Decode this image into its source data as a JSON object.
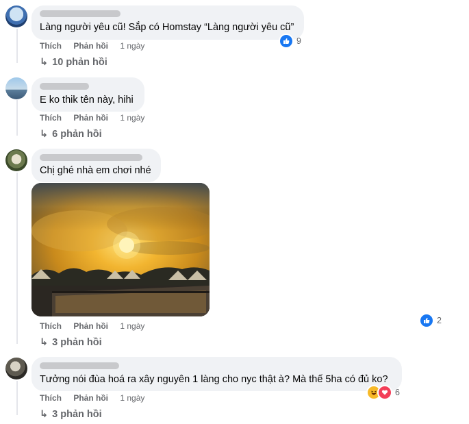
{
  "comments": [
    {
      "text": "Làng người yêu cũ! Sắp có Homstay “Làng người yêu cũ”",
      "actions": {
        "like": "Thích",
        "reply": "Phản hồi",
        "time": "1 ngày"
      },
      "reaction_count": "9",
      "reactions": [
        "like-icon"
      ],
      "replies_label": "10 phản hồi"
    },
    {
      "text": "E ko thik tên này, hihi",
      "actions": {
        "like": "Thích",
        "reply": "Phản hồi",
        "time": "1 ngày"
      },
      "replies_label": "6 phản hồi"
    },
    {
      "text": "Chị ghé nhà em chơi nhé",
      "has_photo": true,
      "actions": {
        "like": "Thích",
        "reply": "Phản hồi",
        "time": "1 ngày"
      },
      "reaction_count": "2",
      "reactions": [
        "like-icon"
      ],
      "replies_label": "3 phản hồi"
    },
    {
      "text": "Tưởng nói đùa hoá ra xây nguyên 1 làng cho nyc thật à? Mà thế 5ha có đủ ko?",
      "actions": {
        "like": "Thích",
        "reply": "Phản hồi",
        "time": "1 ngày"
      },
      "reaction_count": "6",
      "reactions": [
        "haha-icon",
        "love-icon"
      ],
      "replies_label": "3 phản hồi"
    }
  ],
  "colors": {
    "bubble": "#f0f2f5",
    "meta": "#65676b",
    "like": "#1877f2"
  }
}
